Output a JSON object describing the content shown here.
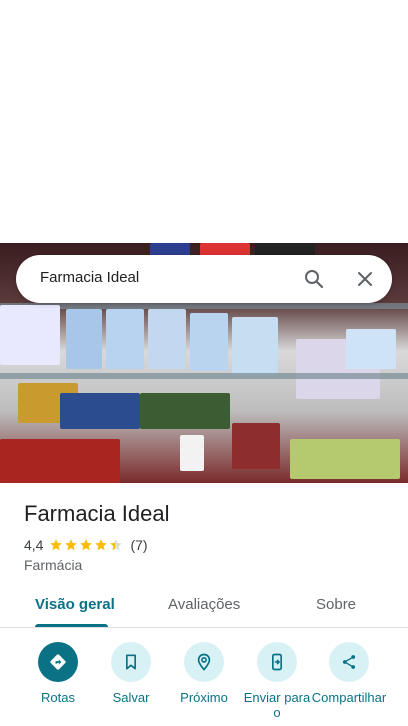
{
  "search": {
    "query": "Farmacia Ideal"
  },
  "place": {
    "name": "Farmacia Ideal",
    "rating": "4,4",
    "stars": 4.4,
    "review_count": "(7)",
    "category": "Farmácia"
  },
  "tabs": [
    {
      "label": "Visão geral",
      "active": true
    },
    {
      "label": "Avaliações",
      "active": false
    },
    {
      "label": "Sobre",
      "active": false
    }
  ],
  "actions": [
    {
      "label": "Rotas",
      "icon": "directions-icon"
    },
    {
      "label": "Salvar",
      "icon": "bookmark-icon"
    },
    {
      "label": "Próximo",
      "icon": "nearby-icon"
    },
    {
      "label": "Enviar para o",
      "icon": "send-to-phone-icon"
    },
    {
      "label": "Compartilhar",
      "icon": "share-icon"
    }
  ],
  "colors": {
    "accent": "#0b7285",
    "accent_light": "#d7f1f5",
    "star": "#fbbc04"
  }
}
